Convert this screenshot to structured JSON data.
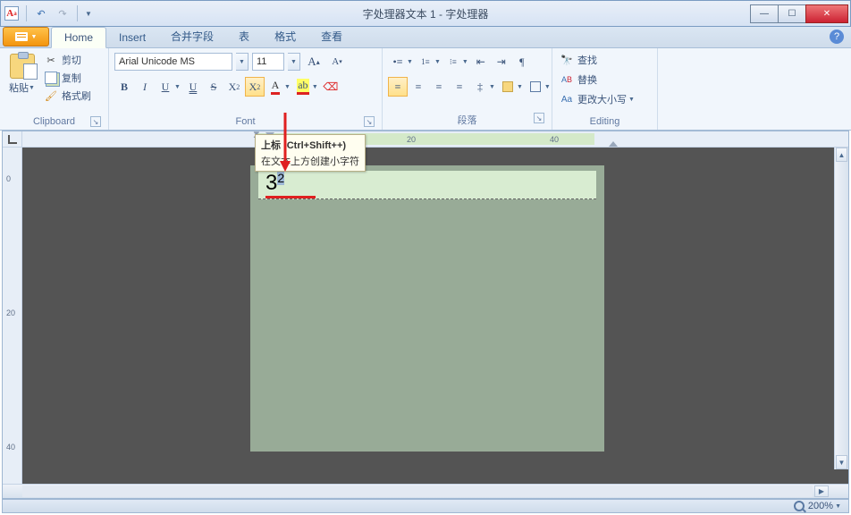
{
  "window": {
    "title": "字处理器文本 1 - 字处理器"
  },
  "tabs": {
    "home": "Home",
    "insert": "Insert",
    "merge": "合并字段",
    "table": "表",
    "format": "格式",
    "view": "查看"
  },
  "groups": {
    "clipboard": {
      "title": "Clipboard",
      "paste": "粘贴",
      "cut": "剪切",
      "copy": "复制",
      "format_painter": "格式刷"
    },
    "font": {
      "title": "Font",
      "font_name": "Arial Unicode MS",
      "font_size": "11"
    },
    "paragraph": {
      "title": "段落"
    },
    "editing": {
      "title": "Editing",
      "find": "查找",
      "replace": "替换",
      "change_case": "更改大小写"
    }
  },
  "tooltip": {
    "title": "上标 (Ctrl+Shift++)",
    "body": "在文本上方创建小字符"
  },
  "ruler": {
    "h_ticks": [
      "20",
      "40"
    ],
    "v_ticks": [
      "0",
      "20",
      "40"
    ]
  },
  "document": {
    "base": "3",
    "sup": "2"
  },
  "status": {
    "zoom": "200%"
  }
}
